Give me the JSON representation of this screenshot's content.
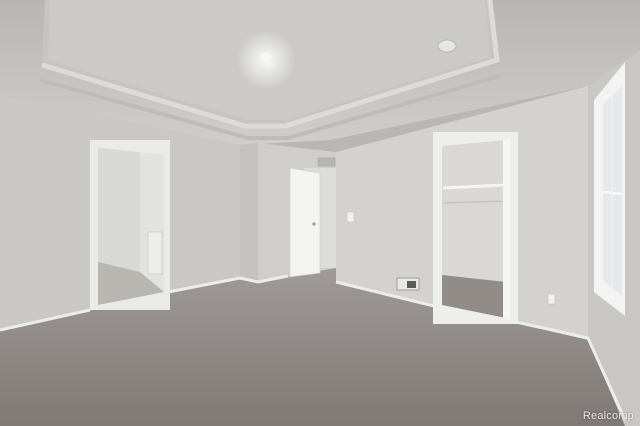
{
  "watermark": {
    "text": "Realcomp"
  },
  "colors": {
    "ceiling": "#c9c8c5",
    "tray": "#d4d3d0",
    "wall_left": "#cfcecb",
    "wall_back": "#d6d5d2",
    "wall_right": "#c8c7c4",
    "trim": "#efefec",
    "carpet": "#8d8784",
    "door": "#f2f2ef",
    "window_glass": "#e9ecee"
  }
}
